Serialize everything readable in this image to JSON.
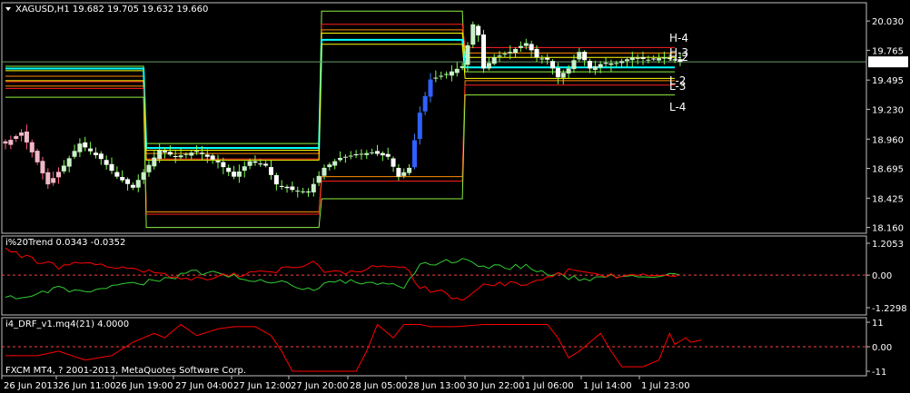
{
  "colors": {
    "background": "#000000",
    "frame": "#c0c0c0",
    "grid": "#404040",
    "text": "#ffffff",
    "bull_candle": "#c8f0c8",
    "bear_candle": "#ffffff",
    "wick": "#7cff4c",
    "cyan_line": "#00ffff",
    "red_line": "#ff2020",
    "orange_line": "#ff8c00",
    "yellow_line": "#ffff00",
    "lime_line": "#90ee40",
    "trend_green": "#32cd32",
    "trend_red": "#ff0000",
    "drf_red": "#ff0000",
    "price_box_bg": "#ffffff",
    "price_box_text": "#000000"
  },
  "header": {
    "menu_icon": "triangle-down-icon",
    "symbol_text": "XAGUSD,H1  19.682 19.705 19.632 19.660"
  },
  "level_labels": [
    "H-4",
    "H-3",
    "H-2",
    "L-2",
    "L-3",
    "L-4"
  ],
  "current_price": "19.660",
  "footer_text": "FXCM MT4, ? 2001-2013, MetaQuotes Software Corp.",
  "chart_data": [
    {
      "type": "candlestick",
      "id": "price",
      "symbol": "XAGUSD",
      "timeframe": "H1",
      "ohlc_last": {
        "open": 19.682,
        "high": 19.705,
        "low": 19.632,
        "close": 19.66
      },
      "y_ticks": [
        "20.030",
        "19.765",
        "19.495",
        "19.230",
        "18.960",
        "18.695",
        "18.425",
        "18.160"
      ],
      "ylim": [
        18.14,
        20.13
      ],
      "current_price": 19.66,
      "x_labels": [
        "26 Jun 2013",
        "26 Jun 11:00",
        "26 Jun 19:00",
        "27 Jun 04:00",
        "27 Jun 12:00",
        "27 Jun 20:00",
        "28 Jun 05:00",
        "28 Jun 13:00",
        "30 Jun 22:00",
        "1 Jul 06:00",
        "1 Jul 14:00",
        "1 Jul 23:00"
      ],
      "n_bars": 128,
      "close_anchors": [
        [
          0,
          18.92
        ],
        [
          3,
          19.02
        ],
        [
          6,
          18.75
        ],
        [
          8,
          18.55
        ],
        [
          11,
          18.72
        ],
        [
          14,
          18.92
        ],
        [
          18,
          18.78
        ],
        [
          21,
          18.62
        ],
        [
          24,
          18.52
        ],
        [
          26,
          18.66
        ],
        [
          29,
          18.86
        ],
        [
          32,
          18.8
        ],
        [
          36,
          18.85
        ],
        [
          40,
          18.75
        ],
        [
          43,
          18.62
        ],
        [
          46,
          18.76
        ],
        [
          49,
          18.72
        ],
        [
          51,
          18.55
        ],
        [
          54,
          18.5
        ],
        [
          57,
          18.48
        ],
        [
          60,
          18.7
        ],
        [
          63,
          18.79
        ],
        [
          66,
          18.82
        ],
        [
          69,
          18.84
        ],
        [
          72,
          18.8
        ],
        [
          74,
          18.62
        ],
        [
          76,
          18.7
        ],
        [
          78,
          19.2
        ],
        [
          80,
          19.5
        ],
        [
          83,
          19.55
        ],
        [
          86,
          19.62
        ],
        [
          88,
          20.0
        ],
        [
          89,
          19.9
        ],
        [
          90,
          19.6
        ],
        [
          92,
          19.7
        ],
        [
          95,
          19.75
        ],
        [
          98,
          19.83
        ],
        [
          100,
          19.7
        ],
        [
          102,
          19.68
        ],
        [
          104,
          19.52
        ],
        [
          106,
          19.6
        ],
        [
          108,
          19.75
        ],
        [
          110,
          19.6
        ],
        [
          112,
          19.64
        ],
        [
          115,
          19.65
        ],
        [
          118,
          19.7
        ],
        [
          121,
          19.68
        ],
        [
          124,
          19.7
        ],
        [
          127,
          19.66
        ]
      ],
      "bear_segment": [
        0,
        10
      ],
      "blue_segment": [
        77,
        80
      ],
      "levels": [
        {
          "name": "lime_outer_top",
          "color": "#90ee40",
          "width": 1,
          "segments": [
            [
              0,
              26,
              19.62
            ],
            [
              26,
              59,
              18.92
            ],
            [
              59,
              86,
              20.12
            ],
            [
              86,
              126,
              19.57
            ]
          ]
        },
        {
          "name": "red_top",
          "color": "#ff2020",
          "width": 1,
          "segments": [
            [
              0,
              26,
              19.48
            ],
            [
              26,
              59,
              18.78
            ],
            [
              59,
              86,
              20.0
            ],
            [
              86,
              126,
              19.79
            ]
          ]
        },
        {
          "name": "orange_top",
          "color": "#ff8c00",
          "width": 1,
          "segments": [
            [
              0,
              26,
              19.53
            ],
            [
              26,
              59,
              18.83
            ],
            [
              59,
              86,
              19.95
            ],
            [
              86,
              126,
              19.74
            ]
          ]
        },
        {
          "name": "yellow_top",
          "color": "#ffff00",
          "width": 1,
          "segments": [
            [
              0,
              26,
              19.58
            ],
            [
              26,
              59,
              18.86
            ],
            [
              59,
              86,
              19.92
            ],
            [
              86,
              126,
              19.7
            ]
          ]
        },
        {
          "name": "cyan",
          "color": "#00ffff",
          "width": 2,
          "segments": [
            [
              0,
              26,
              19.6
            ],
            [
              26,
              59,
              18.88
            ],
            [
              59,
              86,
              19.86
            ],
            [
              86,
              126,
              19.61
            ]
          ]
        },
        {
          "name": "yellow_bottom",
          "color": "#ffff00",
          "width": 1,
          "segments": [
            [
              0,
              26,
              19.49
            ],
            [
              26,
              59,
              18.77
            ],
            [
              59,
              86,
              19.82
            ],
            [
              86,
              126,
              19.51
            ]
          ]
        },
        {
          "name": "orange_bottom",
          "color": "#ff8c00",
          "width": 1,
          "segments": [
            [
              0,
              26,
              19.44
            ],
            [
              26,
              59,
              18.3
            ],
            [
              59,
              86,
              18.62
            ],
            [
              86,
              126,
              19.49
            ]
          ]
        },
        {
          "name": "red_bottom",
          "color": "#ff2020",
          "width": 1,
          "segments": [
            [
              0,
              26,
              19.42
            ],
            [
              26,
              59,
              18.28
            ],
            [
              59,
              86,
              18.58
            ],
            [
              86,
              126,
              19.45
            ]
          ]
        },
        {
          "name": "lime_outer_bottom",
          "color": "#90ee40",
          "width": 1,
          "segments": [
            [
              0,
              26,
              19.34
            ],
            [
              26,
              59,
              18.16
            ],
            [
              59,
              86,
              18.42
            ],
            [
              86,
              126,
              19.36
            ]
          ]
        }
      ]
    },
    {
      "type": "line",
      "id": "trend",
      "title": "i%20Trend 0.0343 -0.0352",
      "y_ticks": [
        "1.2053",
        "0.00",
        "-1.2298"
      ],
      "ylim": [
        -1.2298,
        1.2053
      ],
      "zero_line": true,
      "series": [
        {
          "color": "#32cd32",
          "anchors": [
            [
              0,
              -0.9
            ],
            [
              5,
              -0.7
            ],
            [
              10,
              -0.5
            ],
            [
              15,
              -0.6
            ],
            [
              20,
              -0.4
            ],
            [
              25,
              -0.3
            ],
            [
              30,
              -0.15
            ],
            [
              35,
              0.1
            ],
            [
              40,
              0.05
            ],
            [
              45,
              -0.1
            ],
            [
              50,
              -0.25
            ],
            [
              55,
              -0.4
            ],
            [
              58,
              -0.6
            ],
            [
              60,
              -0.3
            ],
            [
              65,
              -0.2
            ],
            [
              70,
              -0.35
            ],
            [
              75,
              -0.4
            ],
            [
              78,
              0.4
            ],
            [
              82,
              0.5
            ],
            [
              86,
              0.6
            ],
            [
              90,
              0.3
            ],
            [
              94,
              0.3
            ],
            [
              98,
              0.35
            ],
            [
              102,
              0.1
            ],
            [
              106,
              -0.1
            ],
            [
              110,
              -0.15
            ],
            [
              115,
              -0.05
            ],
            [
              120,
              0.0
            ],
            [
              124,
              0.02
            ],
            [
              127,
              0.0
            ]
          ]
        },
        {
          "color": "#ff0000",
          "anchors": [
            [
              0,
              1.0
            ],
            [
              5,
              0.6
            ],
            [
              10,
              0.3
            ],
            [
              15,
              0.5
            ],
            [
              20,
              0.3
            ],
            [
              25,
              0.2
            ],
            [
              30,
              0.05
            ],
            [
              35,
              -0.2
            ],
            [
              40,
              -0.05
            ],
            [
              45,
              0.0
            ],
            [
              50,
              0.15
            ],
            [
              55,
              0.35
            ],
            [
              58,
              0.5
            ],
            [
              60,
              0.2
            ],
            [
              65,
              0.1
            ],
            [
              70,
              0.3
            ],
            [
              75,
              0.35
            ],
            [
              78,
              -0.5
            ],
            [
              82,
              -0.6
            ],
            [
              86,
              -1.0
            ],
            [
              88,
              -0.7
            ],
            [
              90,
              -0.3
            ],
            [
              94,
              -0.35
            ],
            [
              98,
              -0.3
            ],
            [
              102,
              -0.1
            ],
            [
              106,
              0.15
            ],
            [
              110,
              0.05
            ],
            [
              115,
              -0.05
            ],
            [
              120,
              0.0
            ],
            [
              124,
              0.03
            ],
            [
              127,
              0.0
            ]
          ]
        }
      ]
    },
    {
      "type": "line",
      "id": "drf",
      "title": "i4_DRF_v1.mq4(21) 4.0000",
      "y_ticks": [
        "11",
        "0.00",
        "-11"
      ],
      "ylim": [
        -11,
        11
      ],
      "zero_line": true,
      "series": [
        {
          "color": "#ff0000",
          "anchors": [
            [
              0,
              -4
            ],
            [
              6,
              -4
            ],
            [
              10,
              -2
            ],
            [
              15,
              -6
            ],
            [
              20,
              -4
            ],
            [
              24,
              2
            ],
            [
              28,
              6
            ],
            [
              30,
              4
            ],
            [
              33,
              10
            ],
            [
              36,
              5
            ],
            [
              40,
              8
            ],
            [
              43,
              9
            ],
            [
              47,
              9
            ],
            [
              50,
              5
            ],
            [
              52,
              -2
            ],
            [
              54,
              -11
            ],
            [
              57,
              -11
            ],
            [
              64,
              -11
            ],
            [
              66,
              -11
            ],
            [
              68,
              -2
            ],
            [
              70,
              10
            ],
            [
              73,
              4
            ],
            [
              75,
              10
            ],
            [
              78,
              10
            ],
            [
              80,
              9
            ],
            [
              85,
              9
            ],
            [
              90,
              10
            ],
            [
              102,
              10
            ],
            [
              104,
              4
            ],
            [
              106,
              -5
            ],
            [
              108,
              -2
            ],
            [
              110,
              2
            ],
            [
              112,
              6
            ],
            [
              114,
              -2
            ],
            [
              116,
              -9
            ],
            [
              120,
              -9
            ],
            [
              123,
              -6
            ],
            [
              125,
              6
            ],
            [
              126,
              1
            ],
            [
              128,
              4
            ],
            [
              129,
              2
            ],
            [
              131,
              3
            ]
          ]
        }
      ]
    }
  ]
}
